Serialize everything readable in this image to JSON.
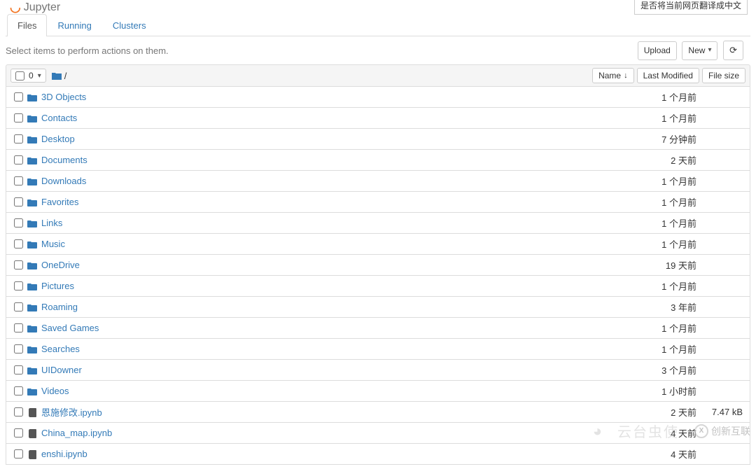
{
  "logo_text": "Jupyter",
  "translate_prompt": "是否将当前网页翻译成中文",
  "tabs": {
    "files": "Files",
    "running": "Running",
    "clusters": "Clusters"
  },
  "hint": "Select items to perform actions on them.",
  "buttons": {
    "upload": "Upload",
    "new": "New",
    "refresh_icon": "⟳"
  },
  "header": {
    "sel_count": "0",
    "breadcrumb_sep": "/",
    "name": "Name",
    "last_modified": "Last Modified",
    "file_size": "File size"
  },
  "rows": [
    {
      "type": "folder",
      "name": "3D Objects",
      "mod": "1 个月前",
      "size": ""
    },
    {
      "type": "folder",
      "name": "Contacts",
      "mod": "1 个月前",
      "size": ""
    },
    {
      "type": "folder",
      "name": "Desktop",
      "mod": "7 分钟前",
      "size": ""
    },
    {
      "type": "folder",
      "name": "Documents",
      "mod": "2 天前",
      "size": ""
    },
    {
      "type": "folder",
      "name": "Downloads",
      "mod": "1 个月前",
      "size": ""
    },
    {
      "type": "folder",
      "name": "Favorites",
      "mod": "1 个月前",
      "size": ""
    },
    {
      "type": "folder",
      "name": "Links",
      "mod": "1 个月前",
      "size": ""
    },
    {
      "type": "folder",
      "name": "Music",
      "mod": "1 个月前",
      "size": ""
    },
    {
      "type": "folder",
      "name": "OneDrive",
      "mod": "19 天前",
      "size": ""
    },
    {
      "type": "folder",
      "name": "Pictures",
      "mod": "1 个月前",
      "size": ""
    },
    {
      "type": "folder",
      "name": "Roaming",
      "mod": "3 年前",
      "size": ""
    },
    {
      "type": "folder",
      "name": "Saved Games",
      "mod": "1 个月前",
      "size": ""
    },
    {
      "type": "folder",
      "name": "Searches",
      "mod": "1 个月前",
      "size": ""
    },
    {
      "type": "folder",
      "name": "UIDowner",
      "mod": "3 个月前",
      "size": ""
    },
    {
      "type": "folder",
      "name": "Videos",
      "mod": "1 小时前",
      "size": ""
    },
    {
      "type": "notebook",
      "name": "恩施修改.ipynb",
      "mod": "2 天前",
      "size": "7.47 kB"
    },
    {
      "type": "notebook",
      "name": "China_map.ipynb",
      "mod": "4 天前",
      "size": ""
    },
    {
      "type": "notebook",
      "name": "enshi.ipynb",
      "mod": "4 天前",
      "size": ""
    }
  ],
  "wm": {
    "left": "云台虫使",
    "right": "创新互联"
  }
}
